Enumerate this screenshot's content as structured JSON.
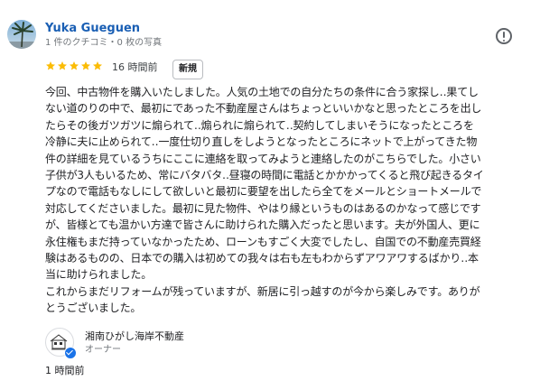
{
  "reviewer": {
    "name": "Yuka Gueguen",
    "meta": "1 件のクチコミ・0 枚の写真"
  },
  "review": {
    "rating": 5,
    "star_color": "#fbbc04",
    "time": "16 時間前",
    "badge": "新規",
    "body_lines": [
      "今回、中古物件を購入いたしました。人気の土地での自分たちの条件に合う家探し‥果てし",
      "ない道のりの中で、最初にであった不動産屋さんはちょっといいかなと思ったところを出し",
      "たらその後ガツガツに煽られて‥煽られに煽られて‥契約してしまいそうになったところを",
      "冷静に夫に止められて‥一度仕切り直しをしようとなったところにネットで上がってきた物",
      "件の詳細を見ているうちにここに連絡を取ってみようと連絡したのがこちらでした。小さい",
      "子供が3人もいるため、常にバタバタ‥昼寝の時間に電話とかかかってくると飛び起きるタイ",
      "プなので電話もなしにして欲しいと最初に要望を出したら全てをメールとショートメールで",
      "対応してくださいました。最初に見た物件、やはり縁というものはあるのかなって感じです",
      "が、皆様とても温かい方達で皆さんに助けられた購入だったと思います。夫が外国人、更に",
      "永住権もまだ持っていなかったため、ローンもすごく大変でしたし、自国での不動産売買経",
      "験はあるものの、日本での購入は初めての我々は右も左もわからずアワアワするばかり‥本",
      "当に助けられました。",
      "これからまだリフォームが残っていますが、新居に引っ越すのが今から楽しみです。ありが",
      "とうございました。"
    ]
  },
  "owner": {
    "name": "湘南ひがし海岸不動産",
    "role": "オーナー",
    "time": "1 時間前"
  },
  "icons": {
    "avatar": "palm-tree-avatar",
    "report": "report-icon",
    "verified": "verified-check-icon"
  }
}
